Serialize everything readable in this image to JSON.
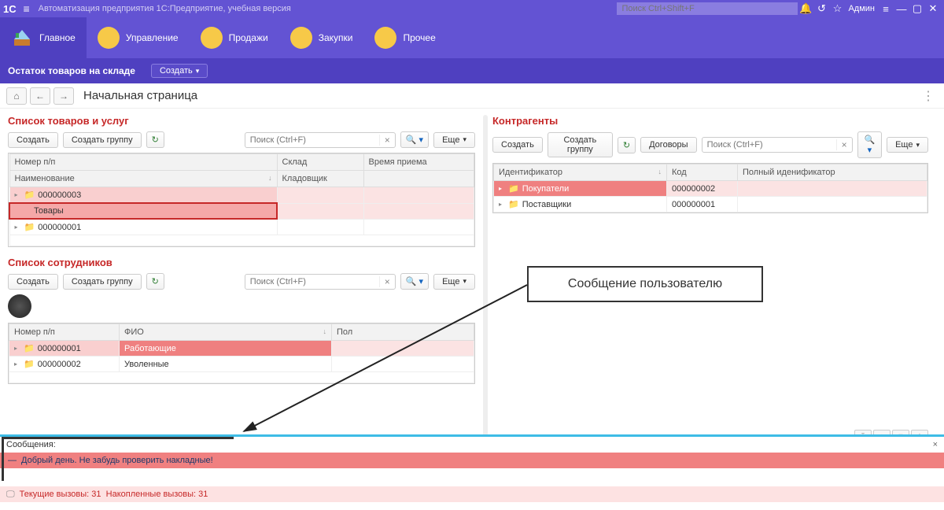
{
  "titlebar": {
    "logo": "1C",
    "app_title": "Автоматизация предприятия 1С:Предприятие, учебная версия",
    "search_placeholder": "Поиск Ctrl+Shift+F",
    "user": "Админ"
  },
  "nav": {
    "items": [
      {
        "label": "Главное"
      },
      {
        "label": "Управление"
      },
      {
        "label": "Продажи"
      },
      {
        "label": "Закупки"
      },
      {
        "label": "Прочее"
      }
    ]
  },
  "subbar": {
    "title": "Остаток товаров на складе",
    "create": "Создать"
  },
  "crumb": {
    "page_title": "Начальная страница"
  },
  "buttons": {
    "create": "Создать",
    "create_group": "Создать группу",
    "more": "Еще",
    "contracts": "Договоры",
    "search_ph": "Поиск (Ctrl+F)"
  },
  "goods": {
    "title": "Список товаров и услуг",
    "cols": {
      "num": "Номер п/п",
      "store": "Склад",
      "time": "Время приема",
      "name": "Наименование",
      "keeper": "Кладовщик"
    },
    "rows": [
      {
        "num": "000000003"
      },
      {
        "name": "Товары"
      },
      {
        "num": "000000001"
      }
    ]
  },
  "staff": {
    "title": "Список сотрудников",
    "cols": {
      "num": "Номер п/п",
      "fio": "ФИО",
      "sex": "Пол"
    },
    "rows": [
      {
        "num": "000000001",
        "fio": "Работающие"
      },
      {
        "num": "000000002",
        "fio": "Уволенные"
      }
    ]
  },
  "contr": {
    "title": "Контрагенты",
    "cols": {
      "id": "Идентификатор",
      "code": "Код",
      "full": "Полный иденификатор"
    },
    "rows": [
      {
        "id": "Покупатели",
        "code": "000000002"
      },
      {
        "id": "Поставщики",
        "code": "000000001"
      }
    ]
  },
  "callout": {
    "text": "Сообщение пользователю"
  },
  "messages": {
    "header": "Сообщения:",
    "text": "Добрый день. Не забудь проверить накладные!"
  },
  "status": {
    "cur_label": "Текущие вызовы:",
    "cur_val": "31",
    "acc_label": "Накопленные вызовы:",
    "acc_val": "31"
  }
}
